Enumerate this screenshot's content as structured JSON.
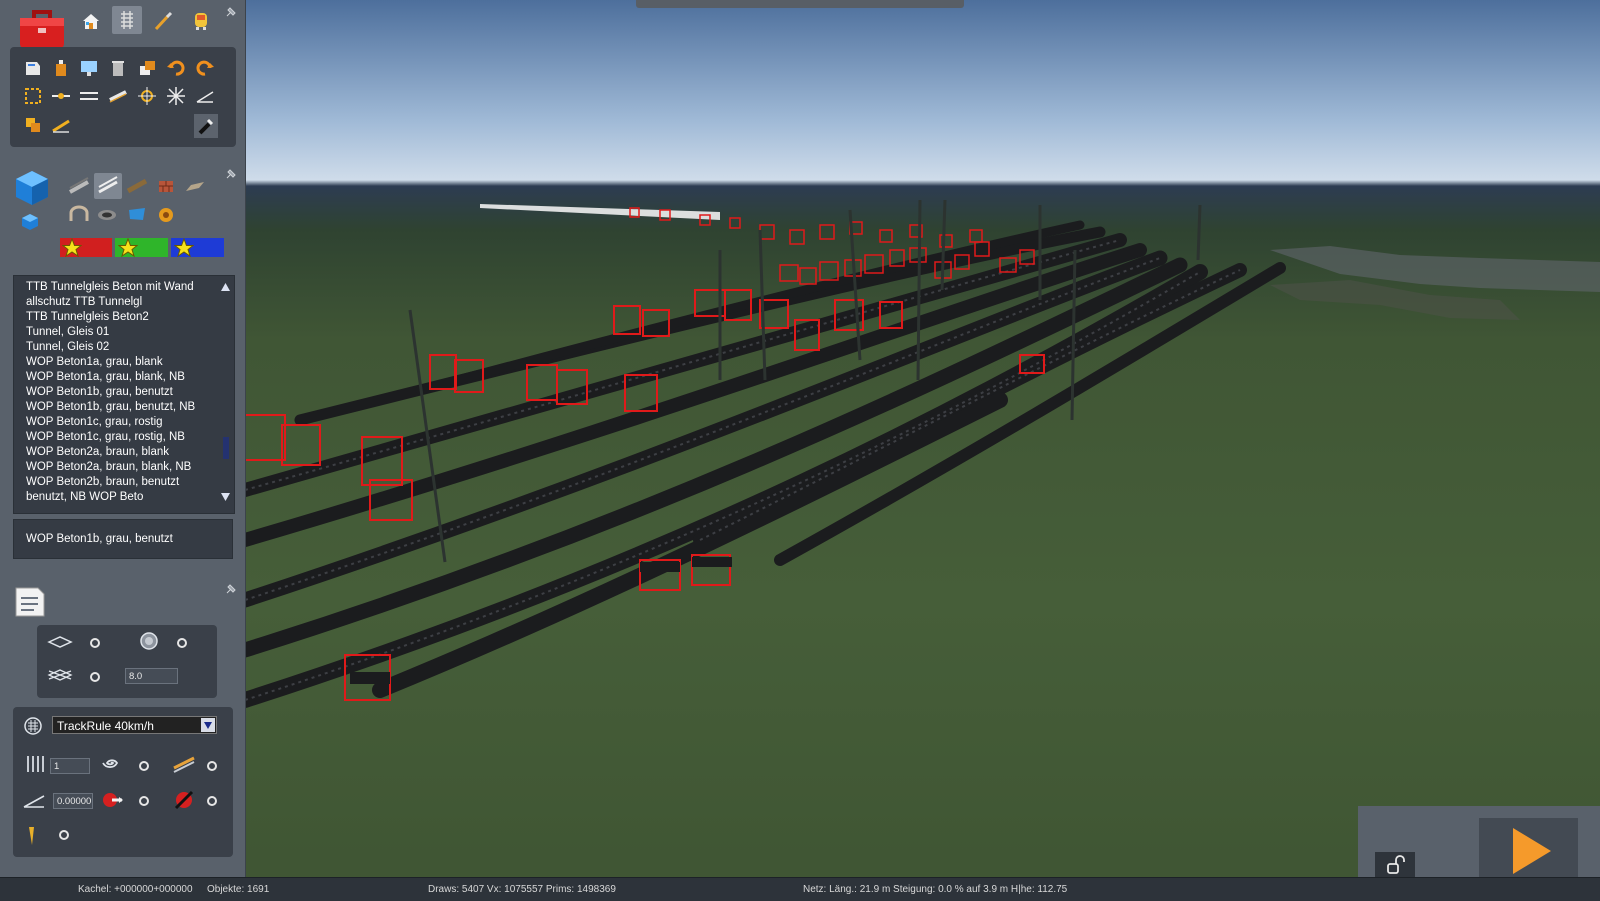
{
  "toolbar": {
    "tools_top": [
      "toolbox-icon",
      "home-icon",
      "track-mode-icon",
      "paint-brush-icon",
      "driver-icon"
    ],
    "edit_tools_row1": [
      "get-info-icon",
      "select-object-icon",
      "monitor-icon",
      "trash-icon",
      "copy-icon",
      "undo-icon",
      "redo-icon"
    ],
    "edit_tools_row2": [
      "marquee-select-icon",
      "split-spline-icon",
      "join-spline-icon",
      "straighten-icon",
      "smooth-icon",
      "crosshair-icon",
      "angle-icon"
    ],
    "edit_tools_row3": [
      "paste-icon",
      "ruler-icon",
      "eyedropper-icon"
    ]
  },
  "asset_categories": {
    "icons": [
      "asset-cube-icon",
      "track-icon",
      "rail-icon",
      "bridge-track-icon",
      "brick-icon",
      "platform-icon",
      "arch-icon",
      "tunnel-icon",
      "water-icon",
      "junction-icon"
    ],
    "favorites": [
      {
        "color": "#d11f1f",
        "icon": "star-icon"
      },
      {
        "color": "#2fb52a",
        "icon": "star-icon"
      },
      {
        "color": "#1e3bd6",
        "icon": "star-icon"
      }
    ]
  },
  "asset_list": [
    "TTB Tunnelgleis Beton mit Wand",
    "allschutz                TTB Tunnelgl",
    "TTB Tunnelgleis Beton2",
    "Tunnel, Gleis 01",
    "Tunnel, Gleis 02",
    "WOP Beton1a, grau, blank",
    "WOP Beton1a, grau, blank, NB",
    "WOP Beton1b, grau, benutzt",
    "WOP Beton1b, grau, benutzt, NB",
    "WOP Beton1c, grau, rostig",
    "WOP Beton1c, grau, rostig, NB",
    "WOP Beton2a, braun, blank",
    "WOP Beton2a, braun, blank, NB",
    "WOP Beton2b, braun, benutzt",
    " benutzt, NB              WOP Beto"
  ],
  "selected_asset": "WOP Beton1b, grau, benutzt",
  "spline_options": {
    "height_value": "8.0"
  },
  "track_options": {
    "track_rule": "TrackRule 40km/h",
    "count_value": "1",
    "grade_value": "0.00000"
  },
  "status": {
    "kachel": "Kachel: +000000+000000",
    "objekte": "Objekte: 1691",
    "draws": "Draws: 5407 Vx: 1075557 Prims: 1498369",
    "netz": "Netz:  Läng.:   21.9 m Steigung:  0.0 % auf  3.9 m H|he: 112.75"
  },
  "colors": {
    "accent_red": "#e01a1a",
    "play_orange": "#f59a2b"
  }
}
